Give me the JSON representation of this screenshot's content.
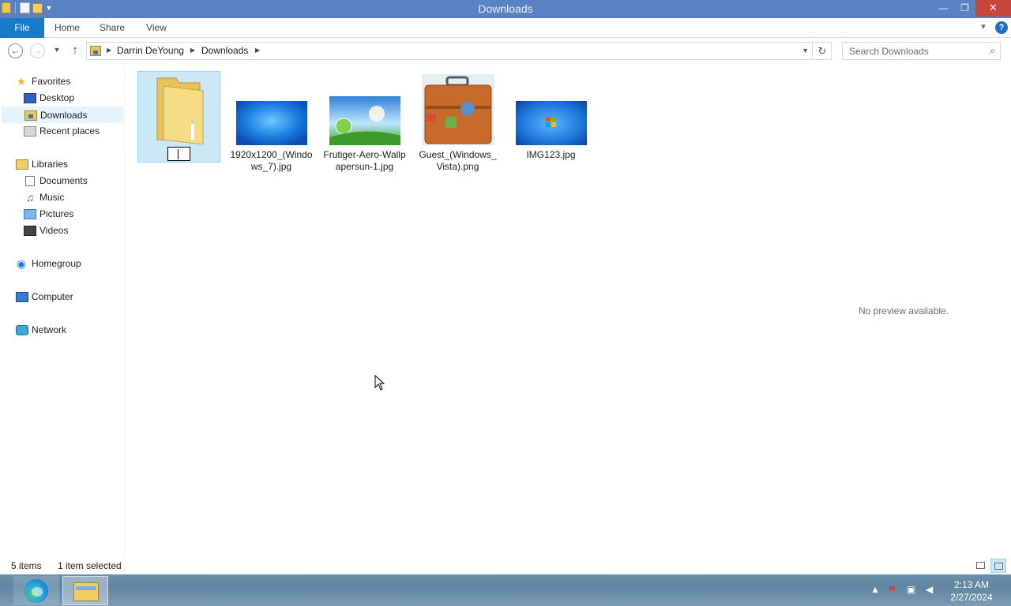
{
  "window": {
    "title": "Downloads",
    "minimize_glyph": "—",
    "restore_glyph": "❐",
    "close_glyph": "✕"
  },
  "ribbon": {
    "tabs": [
      {
        "label": "File"
      },
      {
        "label": "Home"
      },
      {
        "label": "Share"
      },
      {
        "label": "View"
      }
    ],
    "help_glyph": "?"
  },
  "nav": {
    "back_glyph": "←",
    "forward_glyph": "→",
    "up_glyph": "↑",
    "breadcrumbs": [
      "Darrin DeYoung",
      "Downloads"
    ],
    "search_placeholder": "Search Downloads"
  },
  "sidebar": {
    "favorites": {
      "label": "Favorites",
      "items": [
        "Desktop",
        "Downloads",
        "Recent places"
      ]
    },
    "libraries": {
      "label": "Libraries",
      "items": [
        "Documents",
        "Music",
        "Pictures",
        "Videos"
      ]
    },
    "homegroup": "Homegroup",
    "computer": "Computer",
    "network": "Network",
    "selected": "Downloads"
  },
  "files": [
    {
      "name": "",
      "type": "folder",
      "renaming": true,
      "selected": true
    },
    {
      "name": "1920x1200_(Windows_7).jpg",
      "type": "image",
      "thumb": "win7-blue"
    },
    {
      "name": "Frutiger-Aero-Wallpapersun-1.jpg",
      "type": "image",
      "thumb": "aero-nature"
    },
    {
      "name": "Guest_(Windows_Vista).png",
      "type": "image",
      "thumb": "suitcase"
    },
    {
      "name": "IMG123.jpg",
      "type": "image",
      "thumb": "win7-logo"
    }
  ],
  "preview": {
    "text": "No preview available."
  },
  "status": {
    "count": "5 items",
    "selection": "1 item selected"
  },
  "taskbar": {
    "apps": [
      "edge-icon",
      "file-explorer-icon"
    ],
    "time": "2:13 AM",
    "date": "2/27/2024"
  },
  "colors": {
    "titlebar": "#5a82c3",
    "file_tab": "#1979ca",
    "selection": "#cce8f7"
  }
}
